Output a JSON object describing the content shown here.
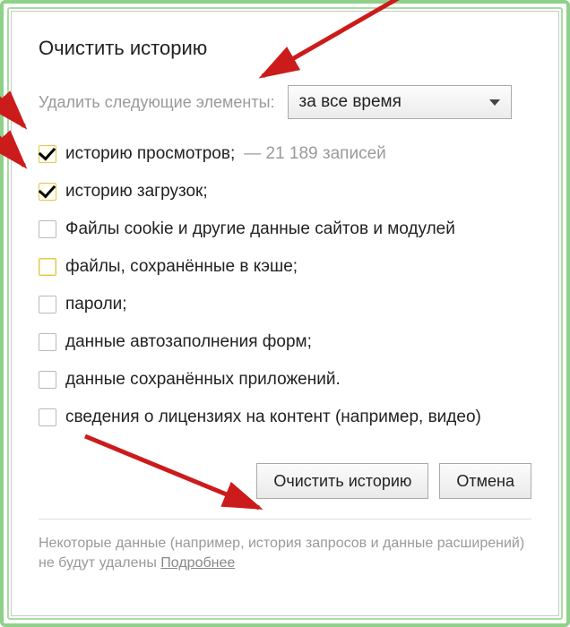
{
  "dialog": {
    "title": "Очистить историю",
    "period_label": "Удалить следующие элементы:",
    "period_value": "за все время",
    "options": [
      {
        "label": "историю просмотров;",
        "suffix": " —  21 189 записей",
        "checked": true,
        "highlighted": false
      },
      {
        "label": "историю загрузок;",
        "suffix": "",
        "checked": true,
        "highlighted": false
      },
      {
        "label": "Файлы cookie и другие данные сайтов и модулей",
        "suffix": "",
        "checked": false,
        "highlighted": false
      },
      {
        "label": "файлы, сохранённые в кэше;",
        "suffix": "",
        "checked": false,
        "highlighted": true
      },
      {
        "label": "пароли;",
        "suffix": "",
        "checked": false,
        "highlighted": false
      },
      {
        "label": "данные автозаполнения форм;",
        "suffix": "",
        "checked": false,
        "highlighted": false
      },
      {
        "label": "данные сохранённых приложений.",
        "suffix": "",
        "checked": false,
        "highlighted": false
      },
      {
        "label": "сведения о лицензиях на контент (например, видео)",
        "suffix": "",
        "checked": false,
        "highlighted": false
      }
    ],
    "clear_button": "Очистить историю",
    "cancel_button": "Отмена",
    "footer_text": "Некоторые данные (например, история запросов и данные расширений) не будут удалены ",
    "footer_link": "Подробнее"
  },
  "annotation_color": "#cc1b1b"
}
